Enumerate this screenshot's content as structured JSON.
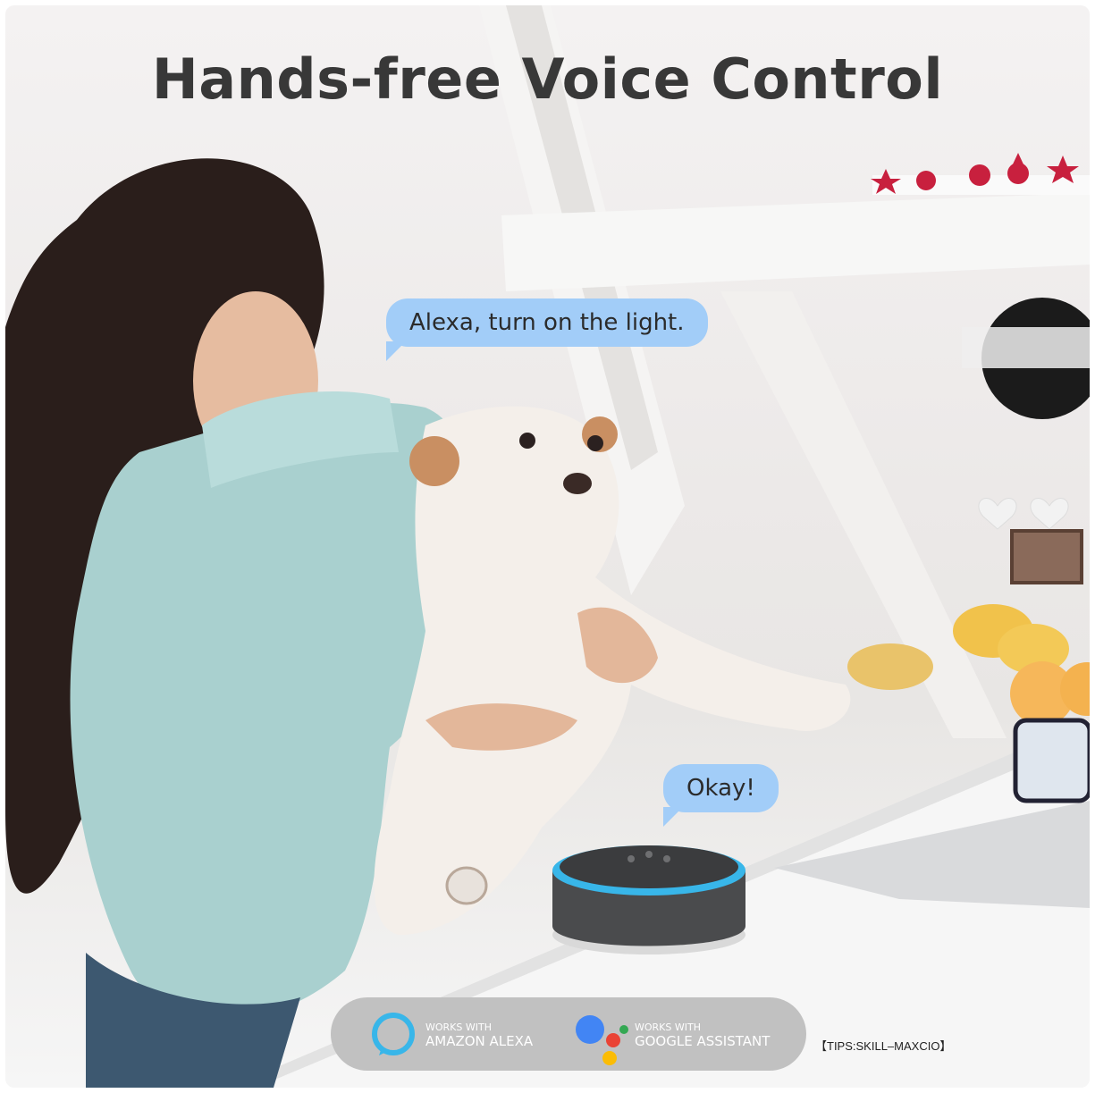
{
  "headline": "Hands-free Voice Control",
  "bubbles": {
    "command": "Alexa, turn on the light.",
    "reply": "Okay!"
  },
  "badges": {
    "alexa": {
      "small": "WORKS WITH",
      "big": "AMAZON ALEXA"
    },
    "google": {
      "small": "WORKS WITH",
      "big": "GOOGLE ASSISTANT"
    }
  },
  "tips": "【TIPS:SKILL–MAXCIO】",
  "colors": {
    "bubble": "#a2cdf8",
    "badge_bar": "#c1c1c1",
    "alexa_ring": "#38b6e9",
    "google_blue": "#4285f4",
    "google_red": "#ea4335",
    "google_yellow": "#fbbc05",
    "google_green": "#34a853"
  }
}
